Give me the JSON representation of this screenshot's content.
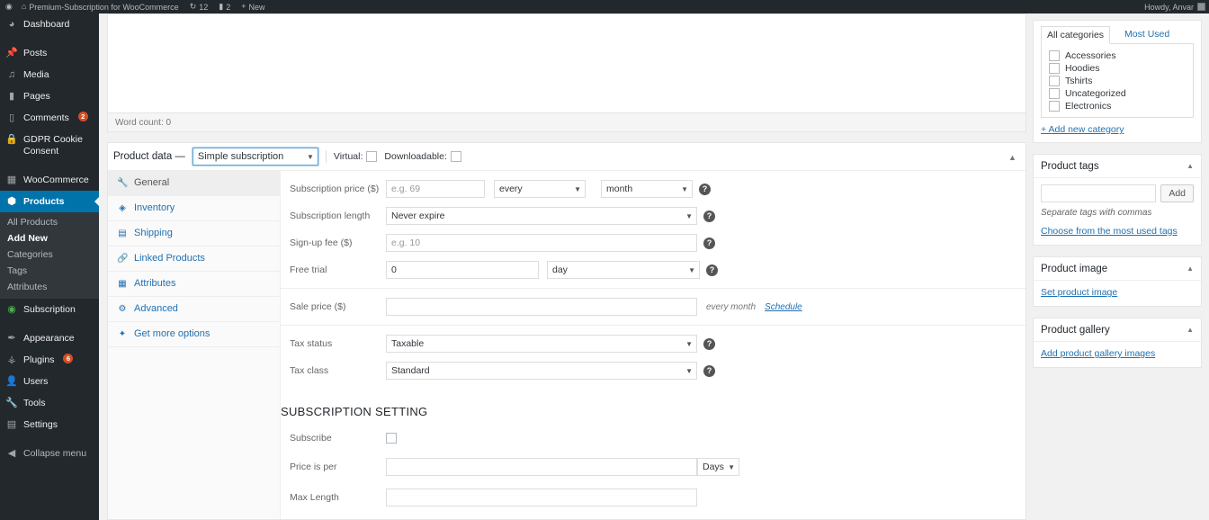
{
  "adminbar": {
    "wp_logo_icon": "wordpress-logo-icon",
    "site_home_icon": "home-icon",
    "site_title": "Premium-Subscription for WooCommerce",
    "updates_icon": "updates-icon",
    "updates_count": "12",
    "comments_icon": "comment-bubble-icon",
    "comments_count": "2",
    "new_icon": "plus-icon",
    "new_label": "New",
    "greeting": "Howdy, Anvar",
    "avatar_icon": "user-avatar-icon"
  },
  "sidebar": {
    "items": [
      {
        "label": "Dashboard",
        "icon": "dashboard-icon",
        "badge": ""
      },
      {
        "label": "Posts",
        "icon": "pin-icon",
        "badge": ""
      },
      {
        "label": "Media",
        "icon": "media-icon",
        "badge": ""
      },
      {
        "label": "Pages",
        "icon": "page-icon",
        "badge": ""
      },
      {
        "label": "Comments",
        "icon": "comment-bubble-icon",
        "badge": "2"
      },
      {
        "label": "GDPR Cookie Consent",
        "icon": "lock-icon",
        "badge": ""
      },
      {
        "label": "WooCommerce",
        "icon": "woocommerce-icon",
        "badge": ""
      },
      {
        "label": "Products",
        "icon": "products-box-icon",
        "badge": ""
      },
      {
        "label": "Subscription",
        "icon": "subscription-icon",
        "badge": ""
      },
      {
        "label": "Appearance",
        "icon": "brush-icon",
        "badge": ""
      },
      {
        "label": "Plugins",
        "icon": "plug-icon",
        "badge": "6"
      },
      {
        "label": "Users",
        "icon": "users-icon",
        "badge": ""
      },
      {
        "label": "Tools",
        "icon": "wrench-icon",
        "badge": ""
      },
      {
        "label": "Settings",
        "icon": "settings-sliders-icon",
        "badge": ""
      },
      {
        "label": "Collapse menu",
        "icon": "collapse-arrow-icon",
        "badge": ""
      }
    ],
    "products_submenu": [
      {
        "label": "All Products"
      },
      {
        "label": "Add New"
      },
      {
        "label": "Categories"
      },
      {
        "label": "Tags"
      },
      {
        "label": "Attributes"
      }
    ],
    "active_item": "Products",
    "active_submenu": "Add New",
    "accent_color": "#0073aa",
    "background_color": "#23282d"
  },
  "editor": {
    "word_count_label": "Word count: 0"
  },
  "product_data": {
    "title": "Product data —",
    "type_value": "Simple subscription",
    "type_caret_icon": "chevron-down-icon",
    "virtual_label": "Virtual:",
    "virtual_checked": false,
    "downloadable_label": "Downloadable:",
    "downloadable_checked": false,
    "collapse_icon": "chevron-up-icon",
    "tabs": [
      {
        "label": "General",
        "icon": "wrench-icon",
        "active": true
      },
      {
        "label": "Inventory",
        "icon": "archive-icon",
        "active": false
      },
      {
        "label": "Shipping",
        "icon": "truck-icon",
        "active": false
      },
      {
        "label": "Linked Products",
        "icon": "link-icon",
        "active": false
      },
      {
        "label": "Attributes",
        "icon": "table-icon",
        "active": false
      },
      {
        "label": "Advanced",
        "icon": "gear-icon",
        "active": false
      },
      {
        "label": "Get more options",
        "icon": "star-icon",
        "active": false
      }
    ],
    "general": {
      "subscription_price": {
        "label": "Subscription price ($)",
        "value": "",
        "placeholder": "e.g. 69",
        "interval_value": "every",
        "period_value": "month",
        "help_icon": "help-icon"
      },
      "subscription_length": {
        "label": "Subscription length",
        "value": "Never expire",
        "help_icon": "help-icon"
      },
      "signup_fee": {
        "label": "Sign-up fee ($)",
        "value": "",
        "placeholder": "e.g. 10",
        "help_icon": "help-icon"
      },
      "free_trial": {
        "label": "Free trial",
        "value": "0",
        "period_value": "day",
        "help_icon": "help-icon"
      },
      "sale_price": {
        "label": "Sale price ($)",
        "value": "",
        "note": "every month",
        "schedule_link": "Schedule"
      },
      "tax_status": {
        "label": "Tax status",
        "value": "Taxable",
        "help_icon": "help-icon"
      },
      "tax_class": {
        "label": "Tax class",
        "value": "Standard",
        "help_icon": "help-icon"
      }
    },
    "subscription_setting": {
      "heading": "SUBSCRIPTION SETTING",
      "subscribe": {
        "label": "Subscribe",
        "checked": false
      },
      "price_is_per": {
        "label": "Price is per",
        "value": "",
        "unit_value": "Days"
      },
      "max_length": {
        "label": "Max Length",
        "value": ""
      }
    }
  },
  "side": {
    "categories_box": {
      "tab_all": "All categories",
      "tab_most_used": "Most Used",
      "items": [
        {
          "label": "Accessories",
          "checked": false
        },
        {
          "label": "Hoodies",
          "checked": false
        },
        {
          "label": "Tshirts",
          "checked": false
        },
        {
          "label": "Uncategorized",
          "checked": false
        },
        {
          "label": "Electronics",
          "checked": false
        }
      ],
      "add_new_link": "+ Add new category"
    },
    "tags_box": {
      "title": "Product tags",
      "input_value": "",
      "add_button": "Add",
      "hint": "Separate tags with commas",
      "most_used_link": "Choose from the most used tags",
      "collapse_icon": "chevron-up-icon"
    },
    "image_box": {
      "title": "Product image",
      "link": "Set product image",
      "collapse_icon": "chevron-up-icon"
    },
    "gallery_box": {
      "title": "Product gallery",
      "link": "Add product gallery images",
      "collapse_icon": "chevron-up-icon"
    }
  }
}
